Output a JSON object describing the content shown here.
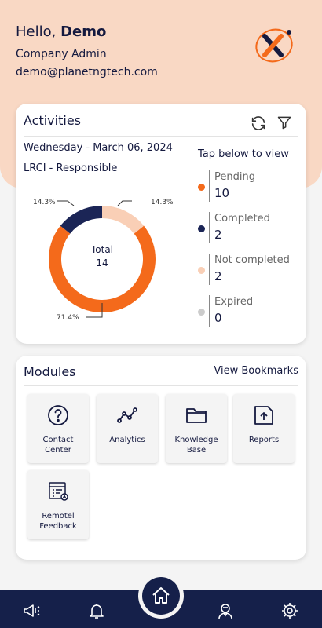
{
  "header": {
    "greeting": "Hello,",
    "user_name": "Demo",
    "role": "Company Admin",
    "email": "demo@planetngtech.com",
    "logo_icon": "planet-x-logo"
  },
  "activities": {
    "title": "Activities",
    "refresh_icon": "refresh-icon",
    "filter_icon": "filter-icon",
    "date": "Wednesday - March 06, 2024",
    "subtitle": "LRCI - Responsible",
    "tap_hint": "Tap below to view",
    "total_label": "Total",
    "total_value": "14",
    "legend": [
      {
        "label": "Pending",
        "count": "10",
        "color": "#f46a1b"
      },
      {
        "label": "Completed",
        "count": "2",
        "color": "#1b2556"
      },
      {
        "label": "Not completed",
        "count": "2",
        "color": "#f9cfb6"
      },
      {
        "label": "Expired",
        "count": "0",
        "color": "#cccccc"
      }
    ]
  },
  "chart_data": {
    "type": "pie",
    "categories": [
      "Pending",
      "Completed",
      "Not completed",
      "Expired"
    ],
    "values": [
      10,
      2,
      2,
      0
    ],
    "percent_labels": [
      "71.4%",
      "14.3%",
      "14.3%"
    ],
    "colors": [
      "#f46a1b",
      "#1b2556",
      "#f9cfb6",
      "#cccccc"
    ],
    "center_label": "Total",
    "center_value": "14"
  },
  "modules": {
    "title": "Modules",
    "view_bookmarks": "View Bookmarks",
    "items": [
      {
        "label": "Contact\nCenter",
        "icon": "question-circle-icon"
      },
      {
        "label": "Analytics",
        "icon": "analytics-line-icon"
      },
      {
        "label": "Knowledge\nBase",
        "icon": "folder-icon"
      },
      {
        "label": "Reports",
        "icon": "report-upload-icon"
      },
      {
        "label": "Remotel\nFeedback",
        "icon": "feedback-form-icon"
      }
    ]
  },
  "navbar": {
    "icons": [
      "megaphone-icon",
      "bell-icon",
      "home-icon",
      "agent-icon",
      "gear-icon"
    ],
    "accent": "#15204a"
  }
}
